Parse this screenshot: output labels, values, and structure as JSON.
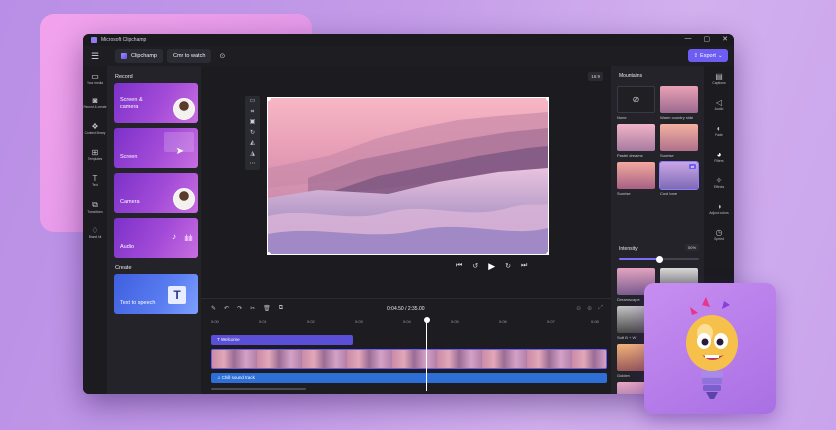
{
  "window": {
    "app_title": "Microsoft Clipchamp",
    "controls": [
      "—",
      "▢",
      "✕"
    ]
  },
  "toolbar": {
    "project_name": "Clipchamp",
    "project_action": "Cmr to watch",
    "export_label": "Export"
  },
  "left_nav": [
    {
      "icon": "folder-icon",
      "glyph": "▭",
      "label": "Your media"
    },
    {
      "icon": "record-icon",
      "glyph": "◙",
      "label": "Record & create"
    },
    {
      "icon": "content-library-icon",
      "glyph": "❖",
      "label": "Content library"
    },
    {
      "icon": "templates-icon",
      "glyph": "⊞",
      "label": "Templates"
    },
    {
      "icon": "text-icon",
      "glyph": "T",
      "label": "Text"
    },
    {
      "icon": "transitions-icon",
      "glyph": "⧉",
      "label": "Transitions"
    },
    {
      "icon": "brand-kit-icon",
      "glyph": "♢",
      "label": "Brand kit"
    }
  ],
  "media": {
    "record_label": "Record",
    "create_label": "Create",
    "cards": [
      {
        "label": "Screen & camera"
      },
      {
        "label": "Screen"
      },
      {
        "label": "Camera"
      },
      {
        "label": "Audio"
      }
    ],
    "tts_label": "Text to speech"
  },
  "stage": {
    "aspect_ratio": "16:9"
  },
  "filters": {
    "title": "Mountains",
    "tiles": [
      {
        "label": "None"
      },
      {
        "label": "Warm country side"
      },
      {
        "label": "Pastel dreams"
      },
      {
        "label": "Sunrise"
      },
      {
        "label": "Sunrise"
      },
      {
        "label": "Cool tone"
      },
      {
        "label": "Dreamscape"
      },
      {
        "label": "Muted B + W"
      },
      {
        "label": "Soft B + W"
      },
      {
        "label": ""
      },
      {
        "label": "Golden"
      },
      {
        "label": ""
      },
      {
        "label": "Dreamy & ..."
      },
      {
        "label": ""
      }
    ],
    "intensity_label": "Intensity",
    "intensity_value": "50%",
    "intensity": 0.5
  },
  "right_nav": [
    {
      "icon": "captions-icon",
      "glyph": "▤",
      "label": "Captions"
    },
    {
      "icon": "audio-icon",
      "glyph": "◁",
      "label": "Audio"
    },
    {
      "icon": "fade-icon",
      "glyph": "◐",
      "label": "Fade"
    },
    {
      "icon": "filters-icon",
      "glyph": "◕",
      "label": "Filters"
    },
    {
      "icon": "effects-icon",
      "glyph": "✧",
      "label": "Effects"
    },
    {
      "icon": "adjust-colors-icon",
      "glyph": "◑",
      "label": "Adjust colors"
    },
    {
      "icon": "speed-icon",
      "glyph": "◷",
      "label": "Speed"
    }
  ],
  "timeline": {
    "current_time": "0:04.50 / 2:35.00",
    "ticks": [
      "0:00",
      "0:01",
      "0:02",
      "0:03",
      "0:04",
      "0:05",
      "0:06",
      "0:07",
      "0:08"
    ],
    "title_track": "Welcome",
    "audio_track": "Chill sound track"
  }
}
